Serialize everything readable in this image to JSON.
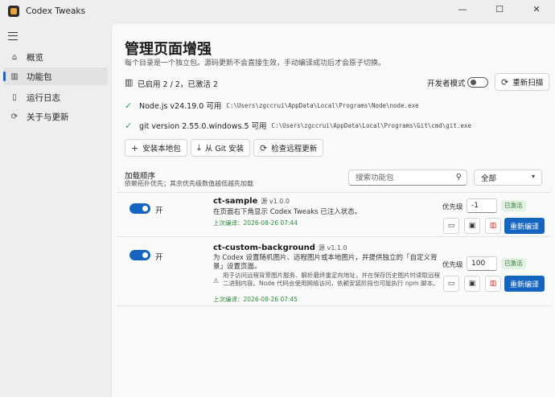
{
  "window": {
    "title": "Codex Tweaks",
    "minimize": "—",
    "maximize": "☐",
    "close": "✕"
  },
  "sidebar": {
    "items": [
      {
        "label": "概览",
        "icon": "home-icon"
      },
      {
        "label": "功能包",
        "icon": "package-icon"
      },
      {
        "label": "运行日志",
        "icon": "document-icon"
      },
      {
        "label": "关于与更新",
        "icon": "refresh-icon"
      }
    ]
  },
  "header": {
    "title": "管理页面增强",
    "subtitle": "每个目录是一个独立包。源码更新不会直接生效，手动编译成功后才会原子切换。"
  },
  "status": {
    "summary": "已启用 2 / 2，已激活 2",
    "dev_mode_label": "开发者模式",
    "rescan_label": "重新扫描"
  },
  "env": [
    {
      "label": "Node.js v24.19.0 可用",
      "path": "C:\\Users\\zgccrui\\AppData\\Local\\Programs\\Node\\node.exe"
    },
    {
      "label": "git version 2.55.0.windows.5 可用",
      "path": "C:\\Users\\zgccrui\\AppData\\Local\\Programs\\Git\\cmd\\git.exe"
    }
  ],
  "actions": {
    "install_local": "安装本地包",
    "install_git": "从 Git 安装",
    "check_updates": "检查远程更新"
  },
  "load_order": {
    "title": "加载顺序",
    "desc": "依赖拓扑优先；其余优先级数值越低越先加载"
  },
  "filter": {
    "search_placeholder": "搜索功能包",
    "select_value": "全部"
  },
  "packages": [
    {
      "toggle_label": "开",
      "name": "ct-sample",
      "source": "源 v1.0.0",
      "desc": "在页面右下角显示 Codex Tweaks 已注入状态。",
      "compiled": "上次编译：2026-08-26 07:44",
      "priority_label": "优先级",
      "priority": "-1",
      "status": "已激活",
      "recompile": "重新编译"
    },
    {
      "toggle_label": "开",
      "name": "ct-custom-background",
      "source": "源 v1.1.0",
      "desc": "为 Codex 设置随机图片、远程图片或本地图片，并提供独立的「自定义背景」设置页面。",
      "notice": "用于访问远程背景图片服务、解析最终重定向地址，并在保存历史图片时读取远程二进制内容。Node 代码会使用网络访问，依赖安装阶段也可能执行 npm 脚本。",
      "compiled": "上次编译：2026-08-26 07:45",
      "priority_label": "优先级",
      "priority": "100",
      "status": "已激活",
      "recompile": "重新编译"
    }
  ],
  "colors": {
    "accent": "#1565c0",
    "success": "#2e9e44",
    "danger": "#d32f2f"
  }
}
